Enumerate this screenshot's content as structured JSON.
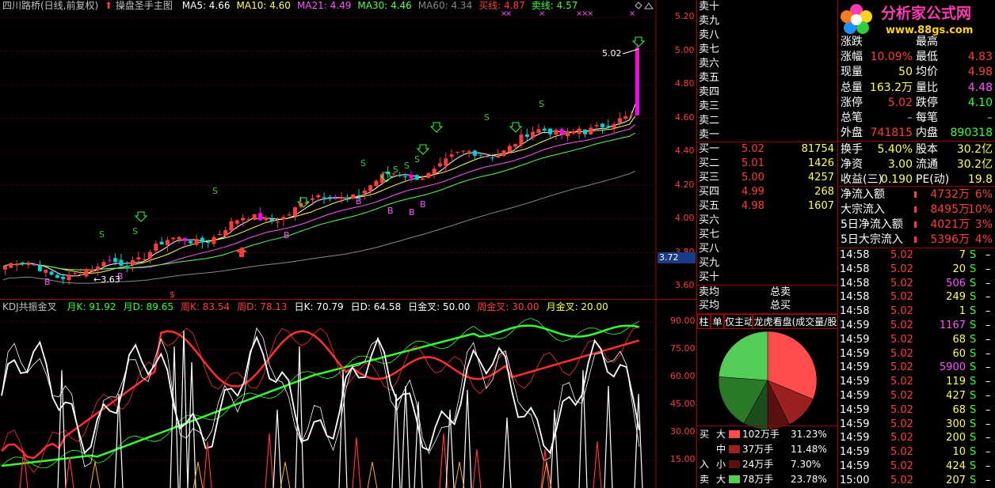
{
  "colors": {
    "up": "#ff3c3c",
    "down": "#00d2d2",
    "magenta": "#ff00ff",
    "yellow": "#ffff55",
    "green": "#33ff33",
    "white": "#ffffff",
    "grid": "#7a0000",
    "border": "#aa0000",
    "buy": "#33cc33",
    "neutral": "#c0c0c0"
  },
  "header": {
    "stock": "四川路桥(日线,前复权)",
    "indicator": "操盘圣手主图",
    "ma": [
      {
        "label": "MA5: 4.66",
        "color": "#ffffff"
      },
      {
        "label": "MA10: 4.60",
        "color": "#ffff55"
      },
      {
        "label": "MA21: 4.49",
        "color": "#ff55ff"
      },
      {
        "label": "MA30: 4.46",
        "color": "#55ff55"
      },
      {
        "label": "MA60: 4.34",
        "color": "#888888"
      },
      {
        "label": "买线: 4.87",
        "color": "#ff3c3c"
      },
      {
        "label": "卖线: 4.57",
        "color": "#33ff33"
      }
    ]
  },
  "kdj": {
    "title": "KDJ共振金叉",
    "items": [
      {
        "label": "月K: 91.92",
        "color": "#33ff33"
      },
      {
        "label": "月D: 89.65",
        "color": "#33ff33"
      },
      {
        "label": "周K: 83.54",
        "color": "#ff3c3c"
      },
      {
        "label": "周D: 78.13",
        "color": "#ff3c3c"
      },
      {
        "label": "日K: 70.79",
        "color": "#ffffff"
      },
      {
        "label": "日D: 64.58",
        "color": "#ffffff"
      },
      {
        "label": "日金叉: 50.00",
        "color": "#ffffff"
      },
      {
        "label": "周金叉: 30.00",
        "color": "#ff3c3c"
      },
      {
        "label": "月金叉: 20.00",
        "color": "#ffff55"
      }
    ],
    "axis": [
      "90.00",
      "75.00",
      "60.00",
      "45.00",
      "30.00",
      "15.00"
    ]
  },
  "price_axis": [
    "5.20",
    "5.00",
    "4.80",
    "4.60",
    "4.40",
    "4.20",
    "4.00",
    "3.80",
    "3.60"
  ],
  "price_marker": "3.72",
  "annotations": {
    "high": "5.02",
    "low": "3.63",
    "buy": "B",
    "sell": "S",
    "cross": "×",
    "dollar": "$"
  },
  "logo": {
    "title": "分析家公式网",
    "url": "www.88gs.com"
  },
  "orderbook": {
    "sell": [
      {
        "label": "卖十",
        "price": "",
        "vol": ""
      },
      {
        "label": "卖九",
        "price": "",
        "vol": ""
      },
      {
        "label": "卖八",
        "price": "",
        "vol": ""
      },
      {
        "label": "卖七",
        "price": "",
        "vol": ""
      },
      {
        "label": "卖六",
        "price": "",
        "vol": ""
      },
      {
        "label": "卖五",
        "price": "",
        "vol": ""
      },
      {
        "label": "卖四",
        "price": "",
        "vol": ""
      },
      {
        "label": "卖三",
        "price": "",
        "vol": ""
      },
      {
        "label": "卖二",
        "price": "",
        "vol": ""
      },
      {
        "label": "卖一",
        "price": "",
        "vol": ""
      }
    ],
    "buy": [
      {
        "label": "买一",
        "price": "5.02",
        "vol": "81754"
      },
      {
        "label": "买二",
        "price": "5.01",
        "vol": "1426"
      },
      {
        "label": "买三",
        "price": "5.00",
        "vol": "4257"
      },
      {
        "label": "买四",
        "price": "4.99",
        "vol": "268"
      },
      {
        "label": "买五",
        "price": "4.98",
        "vol": "1607"
      },
      {
        "label": "买六",
        "price": "",
        "vol": ""
      },
      {
        "label": "买七",
        "price": "",
        "vol": ""
      },
      {
        "label": "买八",
        "price": "",
        "vol": ""
      },
      {
        "label": "买九",
        "price": "",
        "vol": ""
      },
      {
        "label": "买十",
        "price": "",
        "vol": ""
      }
    ],
    "sell_avg": "卖均",
    "buy_avg": "买均",
    "total_sell": "总卖",
    "total_buy": "总买"
  },
  "tabs": [
    "柱",
    "单",
    "仅主动",
    "龙虎看盘(成交量/股"
  ],
  "flow": {
    "title_buy": "买",
    "title_in": "入",
    "title_sell": "卖",
    "rows": [
      {
        "side": "买",
        "size": "大",
        "color": "#ff4d4d",
        "amount": "102万手",
        "pct": "31.23%"
      },
      {
        "side": "",
        "size": "中",
        "color": "#9b2020",
        "amount": "37万手",
        "pct": "11.48%"
      },
      {
        "side": "入",
        "size": "小",
        "color": "#5a1010",
        "amount": "24万手",
        "pct": "7.30%"
      },
      {
        "side": "卖",
        "size": "大",
        "color": "#55cc55",
        "amount": "78万手",
        "pct": "23.78%"
      }
    ],
    "pie": [
      {
        "pct": 31.23,
        "color": "#ff4d4d"
      },
      {
        "pct": 11.48,
        "color": "#9b2020"
      },
      {
        "pct": 7.3,
        "color": "#5a1010"
      },
      {
        "pct": 8.0,
        "color": "#1c4d1c"
      },
      {
        "pct": 18.21,
        "color": "#2a7a2a"
      },
      {
        "pct": 23.78,
        "color": "#55cc55"
      }
    ]
  },
  "quote": {
    "rows": [
      [
        {
          "label": "涨跌",
          "value": "",
          "color": "#ff3c3c"
        },
        {
          "label": "最高",
          "value": "",
          "color": "#ff3c3c"
        }
      ],
      [
        {
          "label": "涨幅",
          "value": "10.09%",
          "color": "#ff3c3c"
        },
        {
          "label": "最低",
          "value": "4.83",
          "color": "#ff3c3c"
        }
      ],
      [
        {
          "label": "现量",
          "value": "50",
          "color": "#ffff55"
        },
        {
          "label": "均价",
          "value": "4.98",
          "color": "#ff3c3c"
        }
      ],
      [
        {
          "label": "总量",
          "value": "163.2万",
          "color": "#ffff55"
        },
        {
          "label": "量比",
          "value": "4.48",
          "color": "#ff55ff"
        }
      ],
      [
        {
          "label": "涨停",
          "value": "5.02",
          "color": "#ff3c3c"
        },
        {
          "label": "跌停",
          "value": "4.10",
          "color": "#33ff33"
        }
      ],
      [
        {
          "label": "总笔",
          "value": "–",
          "color": "#c0c0c0"
        },
        {
          "label": "每笔",
          "value": "–",
          "color": "#c0c0c0"
        }
      ],
      [
        {
          "label": "外盘",
          "value": "741815",
          "color": "#ff3c3c"
        },
        {
          "label": "内盘",
          "value": "890318",
          "color": "#33ff33"
        }
      ]
    ],
    "rows2": [
      [
        {
          "label": "换手",
          "value": "5.40%",
          "color": "#ffff55"
        },
        {
          "label": "股本",
          "value": "30.2亿",
          "color": "#ffff55"
        }
      ],
      [
        {
          "label": "净资",
          "value": "3.00",
          "color": "#ffff55"
        },
        {
          "label": "流通",
          "value": "30.2亿",
          "color": "#ffff55"
        }
      ],
      [
        {
          "label": "收益(三)",
          "value": "0.190",
          "color": "#ffff55"
        },
        {
          "label": "PE(动)",
          "value": "19.8",
          "color": "#ffff55"
        }
      ]
    ],
    "fund": [
      {
        "label": "净流入额",
        "value": "4732万",
        "pct": "6%"
      },
      {
        "label": "大宗流入",
        "value": "8495万",
        "pct": "10%"
      },
      {
        "label": "5日净流入额",
        "value": "4021万",
        "pct": "3%"
      },
      {
        "label": "5日大宗流入",
        "value": "5396万",
        "pct": "4%"
      }
    ]
  },
  "ticks": [
    {
      "time": "14:58",
      "price": "5.02",
      "vol": "7",
      "flag": "S",
      "color": "#ffff55"
    },
    {
      "time": "14:58",
      "price": "5.02",
      "vol": "20",
      "flag": "S",
      "color": "#ffff55"
    },
    {
      "time": "14:58",
      "price": "5.02",
      "vol": "506",
      "flag": "S",
      "color": "#ff55ff"
    },
    {
      "time": "14:58",
      "price": "5.02",
      "vol": "249",
      "flag": "S",
      "color": "#ffff55"
    },
    {
      "time": "14:58",
      "price": "5.02",
      "vol": "1",
      "flag": "S",
      "color": "#ffff55"
    },
    {
      "time": "14:59",
      "price": "5.02",
      "vol": "1167",
      "flag": "S",
      "color": "#ff55ff"
    },
    {
      "time": "14:59",
      "price": "5.02",
      "vol": "68",
      "flag": "S",
      "color": "#ffff55"
    },
    {
      "time": "14:59",
      "price": "5.02",
      "vol": "60",
      "flag": "S",
      "color": "#ffff55"
    },
    {
      "time": "14:59",
      "price": "5.02",
      "vol": "5900",
      "flag": "S",
      "color": "#ff55ff"
    },
    {
      "time": "14:59",
      "price": "5.02",
      "vol": "119",
      "flag": "S",
      "color": "#ffff55"
    },
    {
      "time": "14:59",
      "price": "5.02",
      "vol": "427",
      "flag": "S",
      "color": "#ffff55"
    },
    {
      "time": "14:59",
      "price": "5.02",
      "vol": "68",
      "flag": "S",
      "color": "#ffff55"
    },
    {
      "time": "14:59",
      "price": "5.02",
      "vol": "300",
      "flag": "S",
      "color": "#ffff55"
    },
    {
      "time": "14:59",
      "price": "5.02",
      "vol": "200",
      "flag": "S",
      "color": "#ffff55"
    },
    {
      "time": "14:59",
      "price": "5.02",
      "vol": "10",
      "flag": "S",
      "color": "#ffff55"
    },
    {
      "time": "14:59",
      "price": "5.02",
      "vol": "424",
      "flag": "S",
      "color": "#ffff55"
    },
    {
      "time": "15:00",
      "price": "5.02",
      "vol": "207",
      "flag": "S",
      "color": "#ffff55"
    }
  ]
}
